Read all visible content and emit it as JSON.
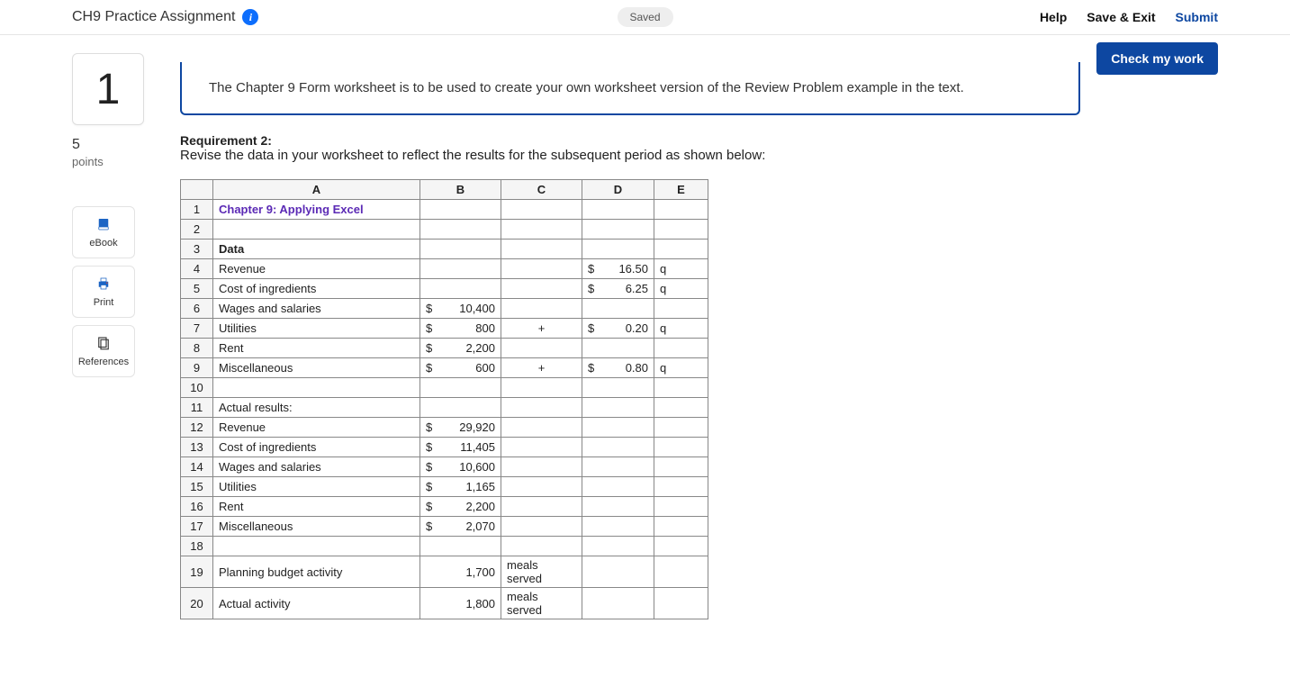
{
  "header": {
    "title": "CH9 Practice Assignment",
    "saved": "Saved",
    "help": "Help",
    "save_exit": "Save & Exit",
    "submit": "Submit"
  },
  "check_button": "Check my work",
  "question": {
    "number": "1",
    "points_value": "5",
    "points_label": "points"
  },
  "tools": {
    "ebook": "eBook",
    "print": "Print",
    "references": "References"
  },
  "prompt": "The Chapter 9 Form worksheet is to be used to create your own worksheet version of the Review Problem example in the text.",
  "requirement": {
    "title": "Requirement 2:",
    "text": "Revise the data in your worksheet to reflect the results for the subsequent period as shown below:"
  },
  "sheet": {
    "cols": [
      "A",
      "B",
      "C",
      "D",
      "E"
    ],
    "rows": [
      {
        "n": "1",
        "A": "Chapter 9: Applying Excel",
        "A_style": "blue bold"
      },
      {
        "n": "2"
      },
      {
        "n": "3",
        "A": "Data",
        "A_style": "bold"
      },
      {
        "n": "4",
        "A": "Revenue",
        "D_sym": "$",
        "D_val": "16.50",
        "E": "q"
      },
      {
        "n": "5",
        "A": "Cost of ingredients",
        "D_sym": "$",
        "D_val": "6.25",
        "E": "q"
      },
      {
        "n": "6",
        "A": "Wages and salaries",
        "B_sym": "$",
        "B_val": "10,400"
      },
      {
        "n": "7",
        "A": "Utilities",
        "B_sym": "$",
        "B_val": "800",
        "C": "+",
        "D_sym": "$",
        "D_val": "0.20",
        "E": "q"
      },
      {
        "n": "8",
        "A": "Rent",
        "B_sym": "$",
        "B_val": "2,200"
      },
      {
        "n": "9",
        "A": "Miscellaneous",
        "B_sym": "$",
        "B_val": "600",
        "C": "+",
        "D_sym": "$",
        "D_val": "0.80",
        "E": "q"
      },
      {
        "n": "10"
      },
      {
        "n": "11",
        "A": "Actual results:"
      },
      {
        "n": "12",
        "A": "Revenue",
        "B_sym": "$",
        "B_val": "29,920"
      },
      {
        "n": "13",
        "A": "Cost of ingredients",
        "B_sym": "$",
        "B_val": "11,405"
      },
      {
        "n": "14",
        "A": "Wages and salaries",
        "B_sym": "$",
        "B_val": "10,600"
      },
      {
        "n": "15",
        "A": "Utilities",
        "B_sym": "$",
        "B_val": "1,165"
      },
      {
        "n": "16",
        "A": "Rent",
        "B_sym": "$",
        "B_val": "2,200"
      },
      {
        "n": "17",
        "A": "Miscellaneous",
        "B_sym": "$",
        "B_val": "2,070"
      },
      {
        "n": "18"
      },
      {
        "n": "19",
        "A": "Planning budget activity",
        "B_val": "1,700",
        "C": "meals served"
      },
      {
        "n": "20",
        "A": "Actual activity",
        "B_val": "1,800",
        "C": "meals served"
      }
    ]
  }
}
